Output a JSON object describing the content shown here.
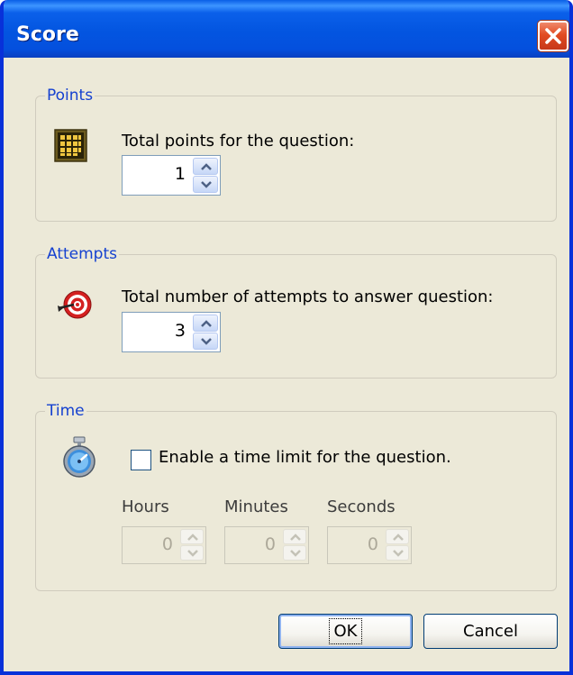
{
  "window": {
    "title": "Score"
  },
  "points": {
    "legend": "Points",
    "label": "Total points for the question:",
    "value": "1"
  },
  "attempts": {
    "legend": "Attempts",
    "label": "Total number of attempts to answer question:",
    "value": "3"
  },
  "time": {
    "legend": "Time",
    "checkbox_label": "Enable a time limit for the question.",
    "enabled": false,
    "hours_label": "Hours",
    "minutes_label": "Minutes",
    "seconds_label": "Seconds",
    "hours_value": "0",
    "minutes_value": "0",
    "seconds_value": "0"
  },
  "buttons": {
    "ok": "OK",
    "cancel": "Cancel"
  },
  "icons": {
    "points": "points-grid-icon",
    "attempts": "target-icon",
    "time": "stopwatch-icon",
    "close": "close-icon"
  },
  "colors": {
    "titlebar": "#0355e0",
    "legend_text": "#1541d0",
    "dialog_bg": "#ece9d8",
    "close_button": "#e24c22"
  }
}
